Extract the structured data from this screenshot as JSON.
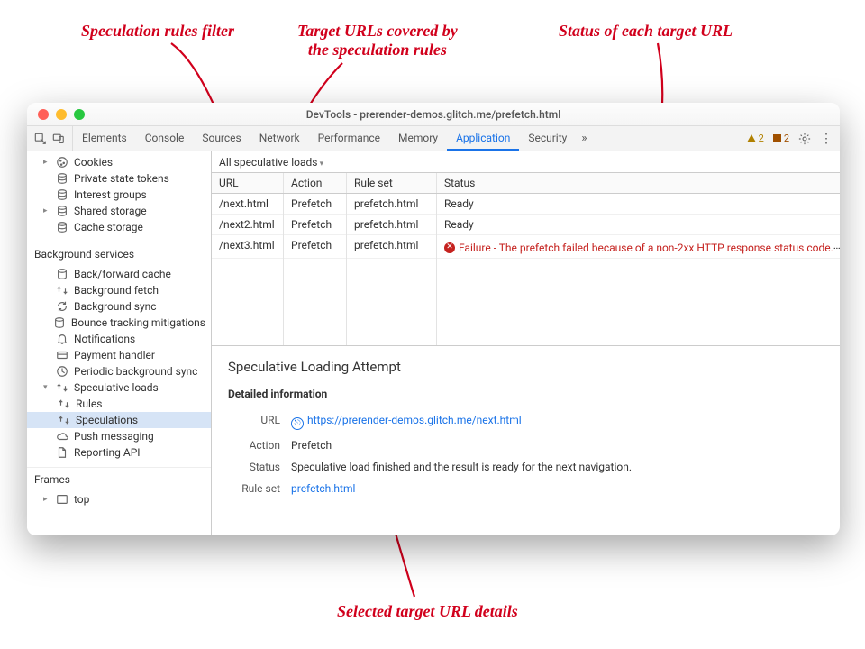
{
  "window": {
    "title": "DevTools - prerender-demos.glitch.me/prefetch.html"
  },
  "tabs": {
    "items": [
      "Elements",
      "Console",
      "Sources",
      "Network",
      "Performance",
      "Memory",
      "Application",
      "Security"
    ],
    "active": "Application",
    "overflow": "»",
    "warnings": "2",
    "issues": "2"
  },
  "sidebar": {
    "storage": {
      "cookies": "Cookies",
      "private_tokens": "Private state tokens",
      "interest_groups": "Interest groups",
      "shared_storage": "Shared storage",
      "cache_storage": "Cache storage"
    },
    "bg_header": "Background services",
    "bg": {
      "bfcache": "Back/forward cache",
      "bgfetch": "Background fetch",
      "bgsync": "Background sync",
      "bounce": "Bounce tracking mitigations",
      "notifications": "Notifications",
      "payment": "Payment handler",
      "periodic": "Periodic background sync",
      "specloads": "Speculative loads",
      "rules": "Rules",
      "speculations": "Speculations",
      "push": "Push messaging",
      "reporting": "Reporting API"
    },
    "frames_header": "Frames",
    "frames": {
      "top": "top"
    }
  },
  "filter": {
    "label": "All speculative loads"
  },
  "table": {
    "headers": {
      "url": "URL",
      "action": "Action",
      "ruleset": "Rule set",
      "status": "Status"
    },
    "rows": [
      {
        "url": "/next.html",
        "action": "Prefetch",
        "ruleset": "prefetch.html",
        "status": "Ready",
        "fail": false
      },
      {
        "url": "/next2.html",
        "action": "Prefetch",
        "ruleset": "prefetch.html",
        "status": "Ready",
        "fail": false
      },
      {
        "url": "/next3.html",
        "action": "Prefetch",
        "ruleset": "prefetch.html",
        "status": "Failure - The prefetch failed because of a non-2xx HTTP response status code.",
        "fail": true
      }
    ]
  },
  "details": {
    "title": "Speculative Loading Attempt",
    "section": "Detailed information",
    "url_label": "URL",
    "url": "https://prerender-demos.glitch.me/next.html",
    "action_label": "Action",
    "action": "Prefetch",
    "status_label": "Status",
    "status": "Speculative load finished and the result is ready for the next navigation.",
    "ruleset_label": "Rule set",
    "ruleset": "prefetch.html"
  },
  "annotations": {
    "filter": "Speculation rules filter",
    "targets": "Target URLs covered by\nthe speculation rules",
    "status": "Status of each target URL",
    "details": "Selected target URL details"
  }
}
